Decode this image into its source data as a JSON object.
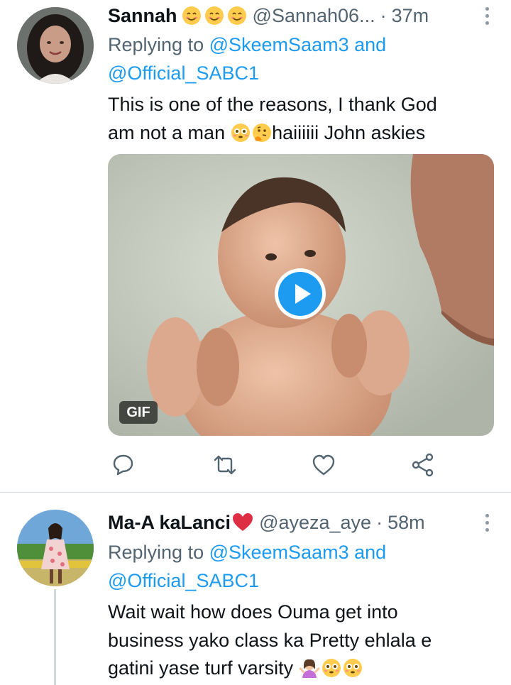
{
  "tweet1": {
    "name": "Sannah",
    "name_emojis": [
      "smiling-face-emoji",
      "smiling-face-emoji",
      "smiling-face-emoji"
    ],
    "handle": "@Sannah06...",
    "separator": "·",
    "time": "37m",
    "replying_prefix": "Replying to",
    "reply_to_1": "@SkeemSaam3",
    "reply_and": "and",
    "reply_to_2": "@Official_SABC1",
    "text_line1": "This is one of the reasons, I thank God",
    "text_line2_a": "am not a man",
    "text_line2_emojis": [
      "flushed-face-emoji",
      "thinking-face-emoji"
    ],
    "text_line2_b": "haiiiiii John askies",
    "media_badge": "GIF",
    "media_type": "animated-gif-with-play-button"
  },
  "tweet2": {
    "name": "Ma-A kaLanci",
    "name_emoji": "red-heart-emoji",
    "handle": "@ayeza_aye",
    "separator": "·",
    "time": "58m",
    "replying_prefix": "Replying to",
    "reply_to_1": "@SkeemSaam3",
    "reply_and": "and",
    "reply_to_2": "@Official_SABC1",
    "text_line1": "Wait wait how does Ouma get into",
    "text_line2": "business yako class  ka Pretty ehlala e",
    "text_line3": "gatini yase turf varsity",
    "text_line3_emojis": [
      "person-shrugging-emoji",
      "flushed-face-emoji",
      "flushed-face-emoji"
    ]
  },
  "colors": {
    "link": "#1d9bf0",
    "secondary_text": "#536471",
    "primary_text": "#0f1419",
    "heart_red": "#dd2e44",
    "divider": "#cfd9de"
  }
}
